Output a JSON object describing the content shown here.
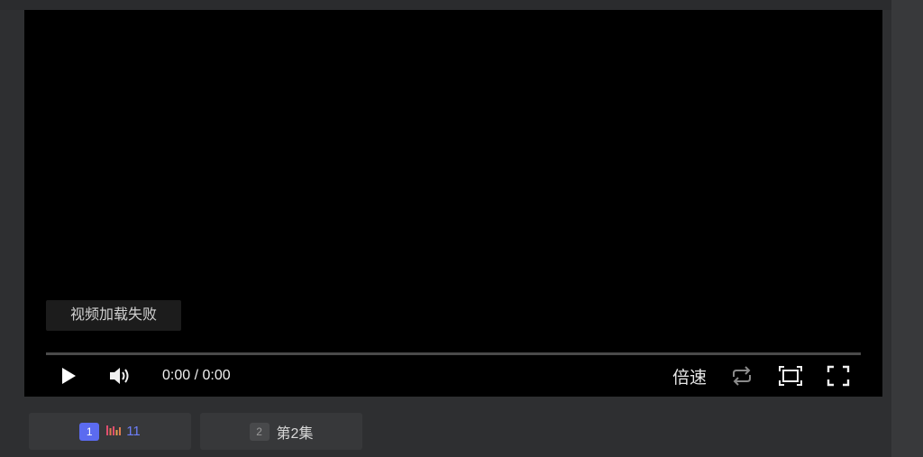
{
  "player": {
    "error_message": "视频加载失败",
    "time_display": "0:00 / 0:00",
    "progress": 0,
    "speed_label": "倍速",
    "icons": [
      "play-icon",
      "volume-icon",
      "loop-icon",
      "webfullscreen-icon",
      "fullscreen-icon"
    ]
  },
  "episodes": [
    {
      "number": "1",
      "label": "11",
      "active": true,
      "accent": "#5b6bf0"
    },
    {
      "number": "2",
      "label": "第2集",
      "active": false
    }
  ]
}
